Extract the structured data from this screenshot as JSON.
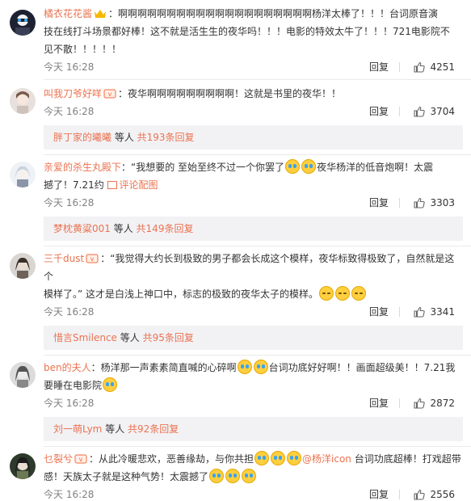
{
  "comments": [
    {
      "user": "橘衣花花酱",
      "line1": "：啊啊啊啊啊啊啊啊啊啊啊啊啊啊啊啊啊啊啊啊杨洋太棒了！！！台词原音演",
      "line2": "技在线打斗场景都好棒！这不就是活生生的夜华吗！！！电影的特效太牛了！！！721电影院不",
      "line3": "见不散！！！！！",
      "time": "今天 16:28",
      "reply": "回复",
      "likes": "4251"
    },
    {
      "user": "叫我刀爷好咩",
      "line1": "：夜华啊啊啊啊啊啊啊啊啊！这就是书里的夜华！！",
      "time": "今天 16:28",
      "reply": "回复",
      "likes": "3704",
      "sub": {
        "who": "胖丁家的曦曦",
        "mid": " 等人 ",
        "total": "共193条回复"
      }
    },
    {
      "user": "亲爱的杀生丸殿下",
      "line1a": "：“我想要的  至始至终不过一个你罢了",
      "line1b": "夜华杨洋的低音炮啊！太震",
      "line2a": "撼了！7.21约  ",
      "picLabel": "评论配图",
      "time": "今天 16:28",
      "reply": "回复",
      "likes": "3303",
      "sub": {
        "who": "梦枕黄粱001",
        "mid": " 等人 ",
        "total": "共149条回复"
      }
    },
    {
      "user": "三千dust",
      "line1": "：“我觉得大约长到极致的男子都会长成这个模样，夜华标致得极致了，自然就是这个",
      "line2": "模样了。” 这才是白浅上神口中，标志的极致的夜华太子的模样。",
      "time": "今天 16:28",
      "reply": "回复",
      "likes": "3341",
      "sub": {
        "who": "惜言Smilence",
        "mid": " 等人 ",
        "total": "共95条回复"
      }
    },
    {
      "user": "ben的夫人",
      "line1a": "：杨洋那一声素素简直喊的心碎啊",
      "line1b": "台词功底好好啊！！画面超级美！！7.21我",
      "line2": "要睡在电影院",
      "time": "今天 16:28",
      "reply": "回复",
      "likes": "2872",
      "sub": {
        "who": "刘一萌Lym",
        "mid": " 等人 ",
        "total": "共92条回复"
      }
    },
    {
      "user": "乜裂兮",
      "line1a": "：从此冷暖悲欢，恶善缘劫，与你共担",
      "mention": "@杨洋icon",
      "line1b": " 台词功底超棒！打戏超带",
      "line2a": "感！天族太子就是这种气势！太震撼了",
      "time": "今天 16:28",
      "reply": "回复",
      "likes": "2556"
    }
  ],
  "colors": {
    "accent": "#eb7350",
    "sub_bg": "#f2f2f5",
    "meta": "#808080"
  },
  "icons": {
    "like": "thumbs-up-icon",
    "vip": "vip-badge-icon",
    "emoji_cry": "cry-emoji-icon",
    "emoji_laugh": "laugh-emoji-icon",
    "picture": "picture-icon"
  }
}
